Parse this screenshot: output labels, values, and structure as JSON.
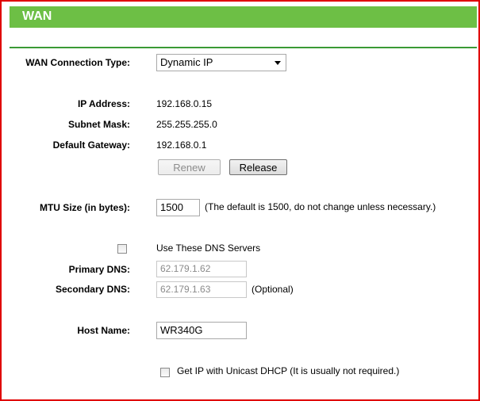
{
  "header": {
    "title": "WAN"
  },
  "form": {
    "connection_type": {
      "label": "WAN Connection Type:",
      "value": "Dynamic IP"
    },
    "ip_address": {
      "label": "IP Address:",
      "value": "192.168.0.15"
    },
    "subnet_mask": {
      "label": "Subnet Mask:",
      "value": "255.255.255.0"
    },
    "default_gateway": {
      "label": "Default Gateway:",
      "value": "192.168.0.1"
    },
    "renew_label": "Renew",
    "release_label": "Release",
    "mtu": {
      "label": "MTU Size (in bytes):",
      "value": "1500",
      "hint": "(The default is 1500, do not change unless necessary.)"
    },
    "dns": {
      "checkbox_label": "Use These DNS Servers",
      "primary_label": "Primary DNS:",
      "primary_value": "62.179.1.62",
      "secondary_label": "Secondary DNS:",
      "secondary_value": "62.179.1.63",
      "optional": "(Optional)"
    },
    "host_name": {
      "label": "Host Name:",
      "value": "WR340G"
    },
    "unicast": {
      "label": "Get IP with Unicast DHCP (It is usually not required.)"
    }
  },
  "colors": {
    "header_green": "#6dbf45",
    "frame_red": "#e00000"
  }
}
